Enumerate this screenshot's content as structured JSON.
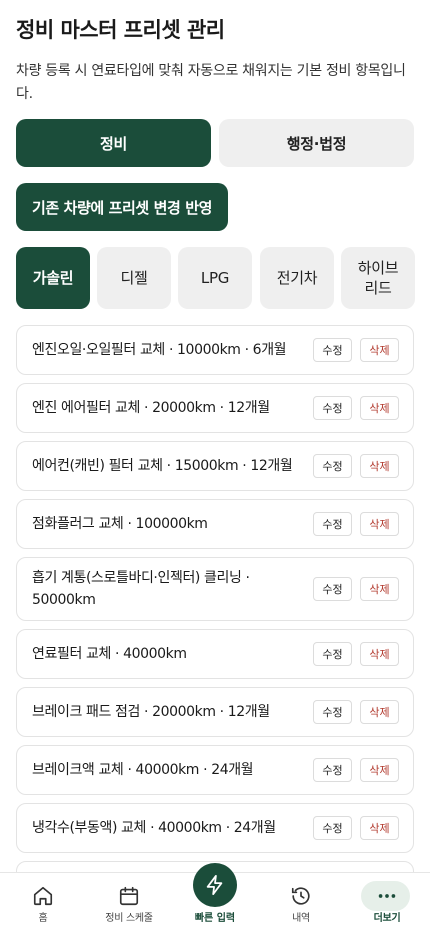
{
  "header": {
    "title": "정비 마스터 프리셋 관리",
    "description": "차량 등록 시 연료타입에 맞춰 자동으로 채워지는 기본 정비 항목입니다."
  },
  "segments": {
    "maintenance": "정비",
    "admin": "행정·법정"
  },
  "apply_button": "기존 차량에 프리셋 변경 반영",
  "fuel_tabs": [
    "가솔린",
    "디젤",
    "LPG",
    "전기차",
    "하이브\n리드"
  ],
  "fuel_selected": "가솔린",
  "item_actions": {
    "edit": "수정",
    "delete": "삭제"
  },
  "items": [
    "엔진오일·오일필터 교체 · 10000km · 6개월",
    "엔진 에어필터 교체 · 20000km · 12개월",
    "에어컨(캐빈) 필터 교체 · 15000km · 12개월",
    "점화플러그 교체 · 100000km",
    "흡기 계통(스로틀바디·인젝터) 클리닝 · 50000km",
    "연료필터 교체 · 40000km",
    "브레이크 패드 점검 · 20000km · 12개월",
    "브레이크액 교체 · 40000km · 24개월",
    "냉각수(부동액) 교체 · 40000km · 24개월",
    ""
  ],
  "tabbar": {
    "home": "홈",
    "schedule": "정비 스케줄",
    "quick": "빠른 입력",
    "history": "내역",
    "more": "더보기"
  },
  "colors": {
    "primary": "#1b4d3a",
    "delete": "#b23a2e",
    "inactive_bg": "#efefef"
  }
}
